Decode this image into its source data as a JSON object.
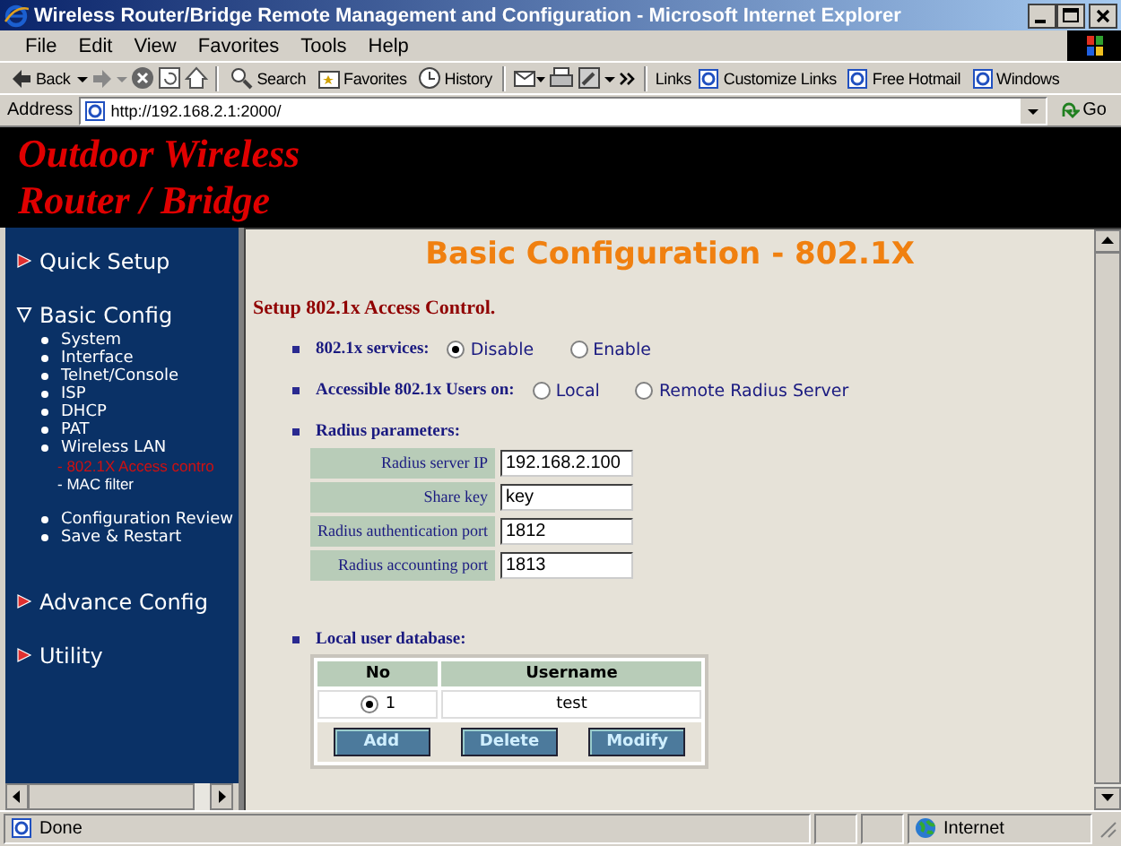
{
  "window": {
    "title": "Wireless Router/Bridge Remote Management and Configuration - Microsoft Internet Explorer"
  },
  "menu": [
    "File",
    "Edit",
    "View",
    "Favorites",
    "Tools",
    "Help"
  ],
  "toolbar": {
    "back": "Back",
    "buttons": [
      "Search",
      "Favorites",
      "History"
    ],
    "links_label": "Links",
    "links": [
      "Customize Links",
      "Free Hotmail",
      "Windows"
    ]
  },
  "address": {
    "label": "Address",
    "value": "http://192.168.2.1:2000/",
    "go": "Go"
  },
  "banner": {
    "lines": [
      "Outdoor Wireless",
      "Router / Bridge"
    ]
  },
  "nav": {
    "sections": [
      {
        "label": "Quick Setup",
        "expanded": false
      },
      {
        "label": "Basic Config",
        "expanded": true,
        "groups": [
          [
            {
              "label": "System"
            },
            {
              "label": "Interface"
            },
            {
              "label": "Telnet/Console"
            },
            {
              "label": "ISP"
            },
            {
              "label": "DHCP"
            },
            {
              "label": "PAT"
            },
            {
              "label": "Wireless LAN",
              "children": [
                {
                  "label": "- 802.1X Access contro",
                  "selected": true
                },
                {
                  "label": "- MAC filter",
                  "selected": false
                }
              ]
            }
          ],
          [
            {
              "label": "Configuration Review"
            },
            {
              "label": "Save & Restart"
            }
          ]
        ]
      },
      {
        "label": "Advance Config",
        "expanded": false
      },
      {
        "label": "Utility",
        "expanded": false
      }
    ]
  },
  "page": {
    "heading": "Basic Configuration - 802.1X",
    "subtitle": "Setup 802.1x Access Control.",
    "services": {
      "label": "802.1x services:",
      "options": [
        {
          "label": "Disable",
          "selected": true
        },
        {
          "label": "Enable",
          "selected": false
        }
      ]
    },
    "users_on": {
      "label": "Accessible 802.1x Users on:",
      "options": [
        {
          "label": "Local",
          "selected": false
        },
        {
          "label": "Remote Radius Server",
          "selected": false
        }
      ]
    },
    "radius": {
      "label": "Radius parameters:",
      "fields": [
        {
          "label": "Radius server IP",
          "value": "192.168.2.100"
        },
        {
          "label": "Share key",
          "value": "key"
        },
        {
          "label": "Radius authentication port",
          "value": "1812"
        },
        {
          "label": "Radius accounting port",
          "value": "1813"
        }
      ]
    },
    "local_db": {
      "label": "Local user database:",
      "columns": [
        "No",
        "Username"
      ],
      "rows": [
        {
          "no": "1",
          "username": "test",
          "selected": true
        }
      ],
      "buttons": [
        "Add",
        "Delete",
        "Modify"
      ]
    }
  },
  "status_bar": {
    "text": "Done",
    "zone": "Internet"
  }
}
